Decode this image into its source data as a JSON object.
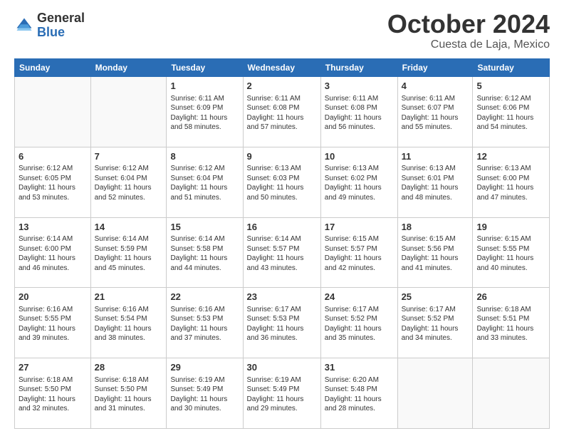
{
  "header": {
    "logo_general": "General",
    "logo_blue": "Blue",
    "title": "October 2024",
    "location": "Cuesta de Laja, Mexico"
  },
  "days_of_week": [
    "Sunday",
    "Monday",
    "Tuesday",
    "Wednesday",
    "Thursday",
    "Friday",
    "Saturday"
  ],
  "weeks": [
    [
      {
        "day": "",
        "sunrise": "",
        "sunset": "",
        "daylight": ""
      },
      {
        "day": "",
        "sunrise": "",
        "sunset": "",
        "daylight": ""
      },
      {
        "day": "1",
        "sunrise": "Sunrise: 6:11 AM",
        "sunset": "Sunset: 6:09 PM",
        "daylight": "Daylight: 11 hours and 58 minutes."
      },
      {
        "day": "2",
        "sunrise": "Sunrise: 6:11 AM",
        "sunset": "Sunset: 6:08 PM",
        "daylight": "Daylight: 11 hours and 57 minutes."
      },
      {
        "day": "3",
        "sunrise": "Sunrise: 6:11 AM",
        "sunset": "Sunset: 6:08 PM",
        "daylight": "Daylight: 11 hours and 56 minutes."
      },
      {
        "day": "4",
        "sunrise": "Sunrise: 6:11 AM",
        "sunset": "Sunset: 6:07 PM",
        "daylight": "Daylight: 11 hours and 55 minutes."
      },
      {
        "day": "5",
        "sunrise": "Sunrise: 6:12 AM",
        "sunset": "Sunset: 6:06 PM",
        "daylight": "Daylight: 11 hours and 54 minutes."
      }
    ],
    [
      {
        "day": "6",
        "sunrise": "Sunrise: 6:12 AM",
        "sunset": "Sunset: 6:05 PM",
        "daylight": "Daylight: 11 hours and 53 minutes."
      },
      {
        "day": "7",
        "sunrise": "Sunrise: 6:12 AM",
        "sunset": "Sunset: 6:04 PM",
        "daylight": "Daylight: 11 hours and 52 minutes."
      },
      {
        "day": "8",
        "sunrise": "Sunrise: 6:12 AM",
        "sunset": "Sunset: 6:04 PM",
        "daylight": "Daylight: 11 hours and 51 minutes."
      },
      {
        "day": "9",
        "sunrise": "Sunrise: 6:13 AM",
        "sunset": "Sunset: 6:03 PM",
        "daylight": "Daylight: 11 hours and 50 minutes."
      },
      {
        "day": "10",
        "sunrise": "Sunrise: 6:13 AM",
        "sunset": "Sunset: 6:02 PM",
        "daylight": "Daylight: 11 hours and 49 minutes."
      },
      {
        "day": "11",
        "sunrise": "Sunrise: 6:13 AM",
        "sunset": "Sunset: 6:01 PM",
        "daylight": "Daylight: 11 hours and 48 minutes."
      },
      {
        "day": "12",
        "sunrise": "Sunrise: 6:13 AM",
        "sunset": "Sunset: 6:00 PM",
        "daylight": "Daylight: 11 hours and 47 minutes."
      }
    ],
    [
      {
        "day": "13",
        "sunrise": "Sunrise: 6:14 AM",
        "sunset": "Sunset: 6:00 PM",
        "daylight": "Daylight: 11 hours and 46 minutes."
      },
      {
        "day": "14",
        "sunrise": "Sunrise: 6:14 AM",
        "sunset": "Sunset: 5:59 PM",
        "daylight": "Daylight: 11 hours and 45 minutes."
      },
      {
        "day": "15",
        "sunrise": "Sunrise: 6:14 AM",
        "sunset": "Sunset: 5:58 PM",
        "daylight": "Daylight: 11 hours and 44 minutes."
      },
      {
        "day": "16",
        "sunrise": "Sunrise: 6:14 AM",
        "sunset": "Sunset: 5:57 PM",
        "daylight": "Daylight: 11 hours and 43 minutes."
      },
      {
        "day": "17",
        "sunrise": "Sunrise: 6:15 AM",
        "sunset": "Sunset: 5:57 PM",
        "daylight": "Daylight: 11 hours and 42 minutes."
      },
      {
        "day": "18",
        "sunrise": "Sunrise: 6:15 AM",
        "sunset": "Sunset: 5:56 PM",
        "daylight": "Daylight: 11 hours and 41 minutes."
      },
      {
        "day": "19",
        "sunrise": "Sunrise: 6:15 AM",
        "sunset": "Sunset: 5:55 PM",
        "daylight": "Daylight: 11 hours and 40 minutes."
      }
    ],
    [
      {
        "day": "20",
        "sunrise": "Sunrise: 6:16 AM",
        "sunset": "Sunset: 5:55 PM",
        "daylight": "Daylight: 11 hours and 39 minutes."
      },
      {
        "day": "21",
        "sunrise": "Sunrise: 6:16 AM",
        "sunset": "Sunset: 5:54 PM",
        "daylight": "Daylight: 11 hours and 38 minutes."
      },
      {
        "day": "22",
        "sunrise": "Sunrise: 6:16 AM",
        "sunset": "Sunset: 5:53 PM",
        "daylight": "Daylight: 11 hours and 37 minutes."
      },
      {
        "day": "23",
        "sunrise": "Sunrise: 6:17 AM",
        "sunset": "Sunset: 5:53 PM",
        "daylight": "Daylight: 11 hours and 36 minutes."
      },
      {
        "day": "24",
        "sunrise": "Sunrise: 6:17 AM",
        "sunset": "Sunset: 5:52 PM",
        "daylight": "Daylight: 11 hours and 35 minutes."
      },
      {
        "day": "25",
        "sunrise": "Sunrise: 6:17 AM",
        "sunset": "Sunset: 5:52 PM",
        "daylight": "Daylight: 11 hours and 34 minutes."
      },
      {
        "day": "26",
        "sunrise": "Sunrise: 6:18 AM",
        "sunset": "Sunset: 5:51 PM",
        "daylight": "Daylight: 11 hours and 33 minutes."
      }
    ],
    [
      {
        "day": "27",
        "sunrise": "Sunrise: 6:18 AM",
        "sunset": "Sunset: 5:50 PM",
        "daylight": "Daylight: 11 hours and 32 minutes."
      },
      {
        "day": "28",
        "sunrise": "Sunrise: 6:18 AM",
        "sunset": "Sunset: 5:50 PM",
        "daylight": "Daylight: 11 hours and 31 minutes."
      },
      {
        "day": "29",
        "sunrise": "Sunrise: 6:19 AM",
        "sunset": "Sunset: 5:49 PM",
        "daylight": "Daylight: 11 hours and 30 minutes."
      },
      {
        "day": "30",
        "sunrise": "Sunrise: 6:19 AM",
        "sunset": "Sunset: 5:49 PM",
        "daylight": "Daylight: 11 hours and 29 minutes."
      },
      {
        "day": "31",
        "sunrise": "Sunrise: 6:20 AM",
        "sunset": "Sunset: 5:48 PM",
        "daylight": "Daylight: 11 hours and 28 minutes."
      },
      {
        "day": "",
        "sunrise": "",
        "sunset": "",
        "daylight": ""
      },
      {
        "day": "",
        "sunrise": "",
        "sunset": "",
        "daylight": ""
      }
    ]
  ]
}
